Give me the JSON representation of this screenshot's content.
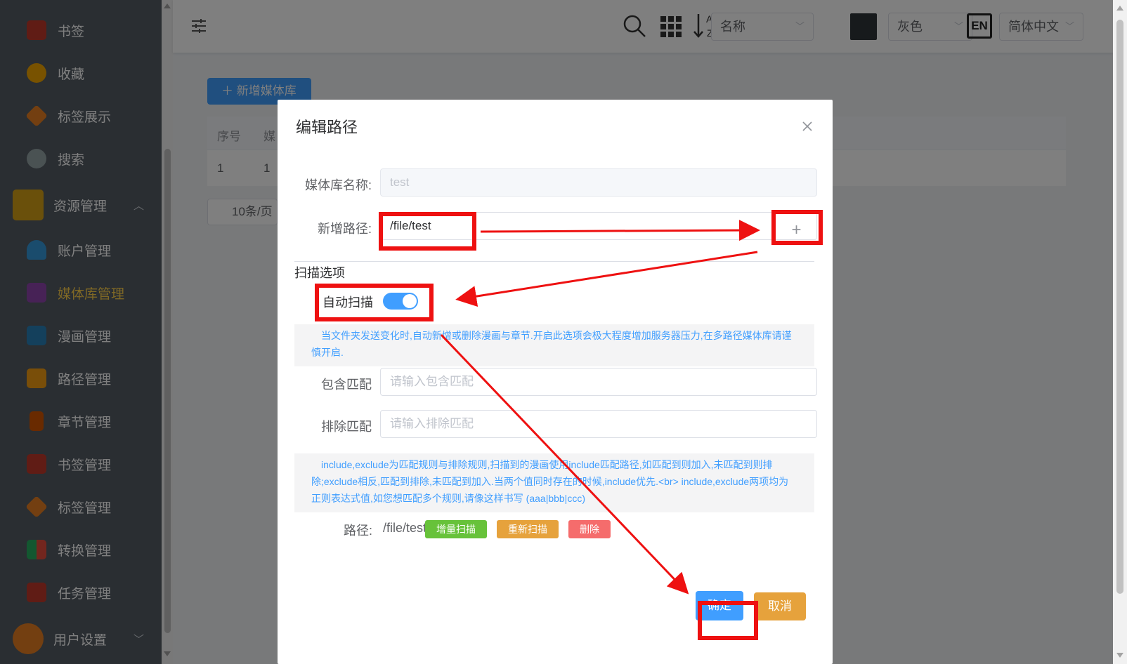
{
  "sidebar": {
    "items": [
      {
        "label": "书签",
        "icon": "bookmark-icon",
        "color": "#c0392b"
      },
      {
        "label": "收藏",
        "icon": "star-icon",
        "color": "#f0a500"
      },
      {
        "label": "标签展示",
        "icon": "tag-icon",
        "color": "#e67e22"
      },
      {
        "label": "搜索",
        "icon": "magnifier-icon",
        "color": "#7f8c8d"
      },
      {
        "label": "资源管理",
        "icon": "box-icon",
        "color": "#d4a017"
      },
      {
        "label": "账户管理",
        "icon": "user-icon",
        "color": "#3498db"
      },
      {
        "label": "媒体库管理",
        "icon": "books-icon",
        "color": "#8e44ad"
      },
      {
        "label": "漫画管理",
        "icon": "book-stack-icon",
        "color": "#2980b9"
      },
      {
        "label": "路径管理",
        "icon": "folder-icon",
        "color": "#f39c12"
      },
      {
        "label": "章节管理",
        "icon": "notebook-icon",
        "color": "#d35400"
      },
      {
        "label": "书签管理",
        "icon": "bookmark-manage-icon",
        "color": "#c0392b"
      },
      {
        "label": "标签管理",
        "icon": "tag-manage-icon",
        "color": "#e67e22"
      },
      {
        "label": "转换管理",
        "icon": "convert-icon",
        "color": "#27ae60"
      },
      {
        "label": "任务管理",
        "icon": "task-icon",
        "color": "#c0392b"
      },
      {
        "label": "用户设置",
        "icon": "settings-gear-icon",
        "color": "#e67e22"
      }
    ],
    "active_color": "#ffd04b"
  },
  "header": {
    "sort_select": "名称",
    "theme_select": "灰色",
    "lang_badge": "EN",
    "lang_select": "简体中文"
  },
  "page": {
    "add_button": "新增媒体库",
    "table_headers": [
      "序号",
      "媒"
    ],
    "table_row": [
      "1",
      "1"
    ],
    "pager_size": "10条/页"
  },
  "dialog": {
    "title": "编辑路径",
    "name_label": "媒体库名称:",
    "name_value": "test",
    "newpath_label": "新增路径:",
    "newpath_value": "/file/test",
    "plus": "+",
    "scan_section": "扫描选项",
    "auto_scan_label": "自动扫描",
    "auto_scan_on": true,
    "auto_scan_tip": "当文件夹发送变化时,自动新增或删除漫画与章节.开启此选项会极大程度增加服务器压力,在多路径媒体库请谨慎开启.",
    "include_label": "包含匹配",
    "include_placeholder": "请输入包含匹配",
    "exclude_label": "排除匹配",
    "exclude_placeholder": "请输入排除匹配",
    "regex_tip": "include,exclude为匹配规则与排除规则,扫描到的漫画使用include匹配路径,如匹配到则加入,未匹配到则排除;exclude相反,匹配到排除,未匹配到加入.当两个值同时存在的时候,include优先.<br> include,exclude两项均为正则表达式值,如您想匹配多个规则,请像这样书写 (aaa|bbb|ccc)",
    "path_label": "路径:",
    "path_value": "/file/test",
    "btn_incremental": "增量扫描",
    "btn_rescan": "重新扫描",
    "btn_delete": "删除",
    "ok": "确定",
    "cancel": "取消"
  },
  "colors": {
    "primary": "#409eff",
    "success": "#67c23a",
    "warning": "#e6a23c",
    "danger": "#f56c6c",
    "annotation": "#ee1111"
  }
}
